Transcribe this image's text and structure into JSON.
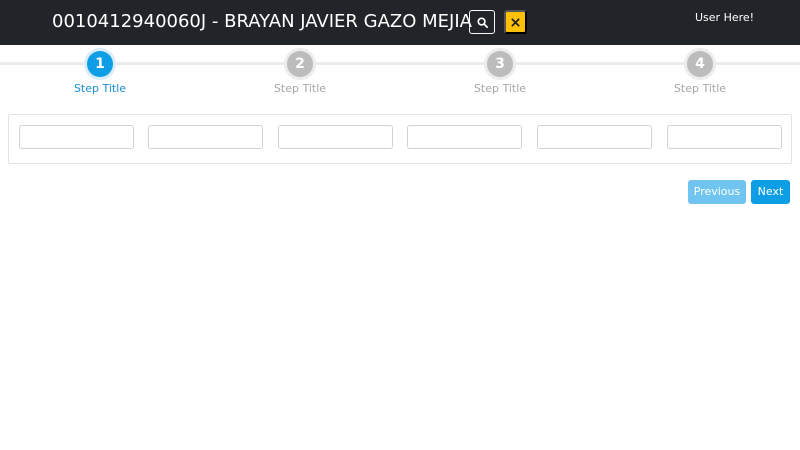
{
  "header": {
    "patient_title": "0010412940060J - BRAYAN JAVIER GAZO MEJIA",
    "search_icon": "search-icon",
    "close_icon": "close-icon",
    "close_button_color": "#ffc107",
    "user_label": "User Here!",
    "background_color": "#212529"
  },
  "steps": [
    {
      "number": "1",
      "title": "Step Title",
      "state": "active"
    },
    {
      "number": "2",
      "title": "Step Title",
      "state": "inactive"
    },
    {
      "number": "3",
      "title": "Step Title",
      "state": "inactive"
    },
    {
      "number": "4",
      "title": "Step Title",
      "state": "inactive"
    }
  ],
  "fields": [
    {
      "value": "",
      "placeholder": ""
    },
    {
      "value": "",
      "placeholder": ""
    },
    {
      "value": "",
      "placeholder": ""
    },
    {
      "value": "",
      "placeholder": ""
    },
    {
      "value": "",
      "placeholder": ""
    },
    {
      "value": "",
      "placeholder": ""
    }
  ],
  "navigation": {
    "previous_label": "Previous",
    "next_label": "Next",
    "accent_color": "#0d9ee6"
  }
}
